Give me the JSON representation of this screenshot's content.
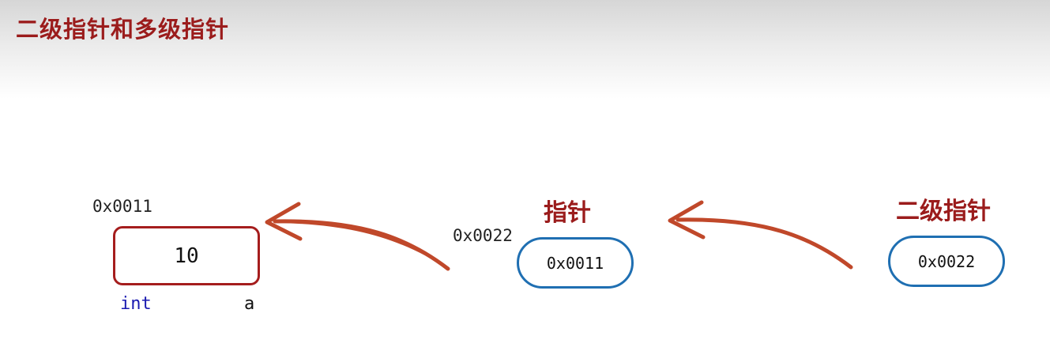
{
  "title": "二级指针和多级指针",
  "variable": {
    "address": "0x0011",
    "value": "10",
    "type": "int",
    "name": "a"
  },
  "pointer": {
    "title": "指针",
    "address": "0x0022",
    "value": "0x0011"
  },
  "double_pointer": {
    "title": "二级指针",
    "value": "0x0022"
  },
  "colors": {
    "title_red": "#9b1c1c",
    "box_border_red": "#a51d1d",
    "pill_border_blue": "#1f6fb2",
    "arrow_orange": "#c0482a",
    "type_blue": "#1a1ab0"
  }
}
